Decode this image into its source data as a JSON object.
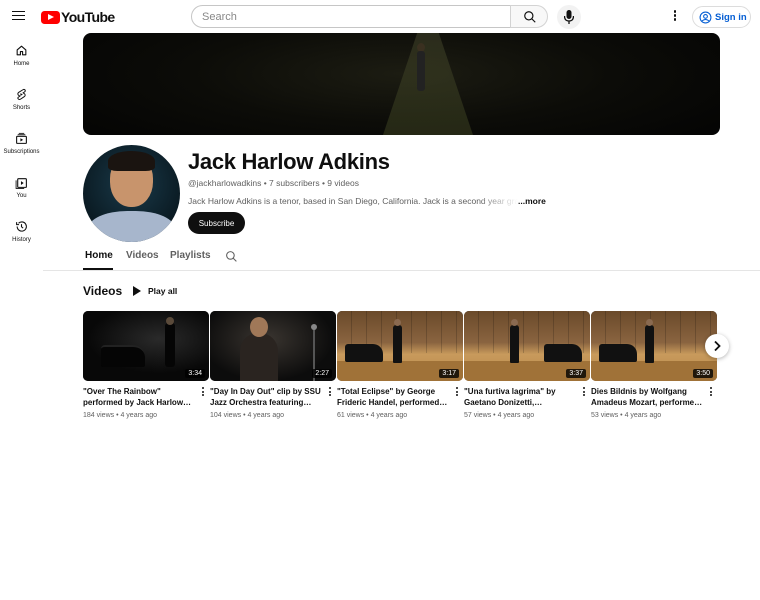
{
  "header": {
    "logo_text": "YouTube",
    "search_placeholder": "Search",
    "signin_label": "Sign in"
  },
  "sidebar": {
    "items": [
      {
        "label": "Home",
        "icon": "home-icon"
      },
      {
        "label": "Shorts",
        "icon": "shorts-icon"
      },
      {
        "label": "Subscriptions",
        "icon": "subscriptions-icon"
      },
      {
        "label": "You",
        "icon": "you-icon"
      },
      {
        "label": "History",
        "icon": "history-icon"
      }
    ]
  },
  "channel": {
    "name": "Jack Harlow Adkins",
    "meta": "@jackharlowadkins • 7 subscribers • 9 videos",
    "description": "Jack Harlow Adkins is a tenor, based in San Diego, California. Jack is a second year graduate",
    "more_label": "...more",
    "subscribe_label": "Subscribe"
  },
  "tabs": [
    {
      "label": "Home",
      "active": true
    },
    {
      "label": "Videos",
      "active": false
    },
    {
      "label": "Playlists",
      "active": false
    }
  ],
  "shelf": {
    "title": "Videos",
    "play_all_label": "Play all"
  },
  "videos": [
    {
      "title": "\"Over The Rainbow\" performed by Jack Harlow…",
      "meta": "184 views • 4 years ago",
      "duration": "3:34"
    },
    {
      "title": "\"Day In Day Out\" clip by SSU Jazz Orchestra featuring…",
      "meta": "104 views • 4 years ago",
      "duration": "2:27"
    },
    {
      "title": "\"Total Eclipse\" by George Frideric Handel, performed…",
      "meta": "61 views • 4 years ago",
      "duration": "3:17"
    },
    {
      "title": "\"Una furtiva lagrima\" by Gaetano Donizetti,…",
      "meta": "57 views • 4 years ago",
      "duration": "3:37"
    },
    {
      "title": "Dies Bildnis by Wolfgang Amadeus Mozart, performe…",
      "meta": "53 views • 4 years ago",
      "duration": "3:50"
    }
  ],
  "colors": {
    "brand_red": "#ff0000",
    "link_blue": "#065fd4",
    "text_primary": "#0f0f0f",
    "text_secondary": "#606060"
  }
}
